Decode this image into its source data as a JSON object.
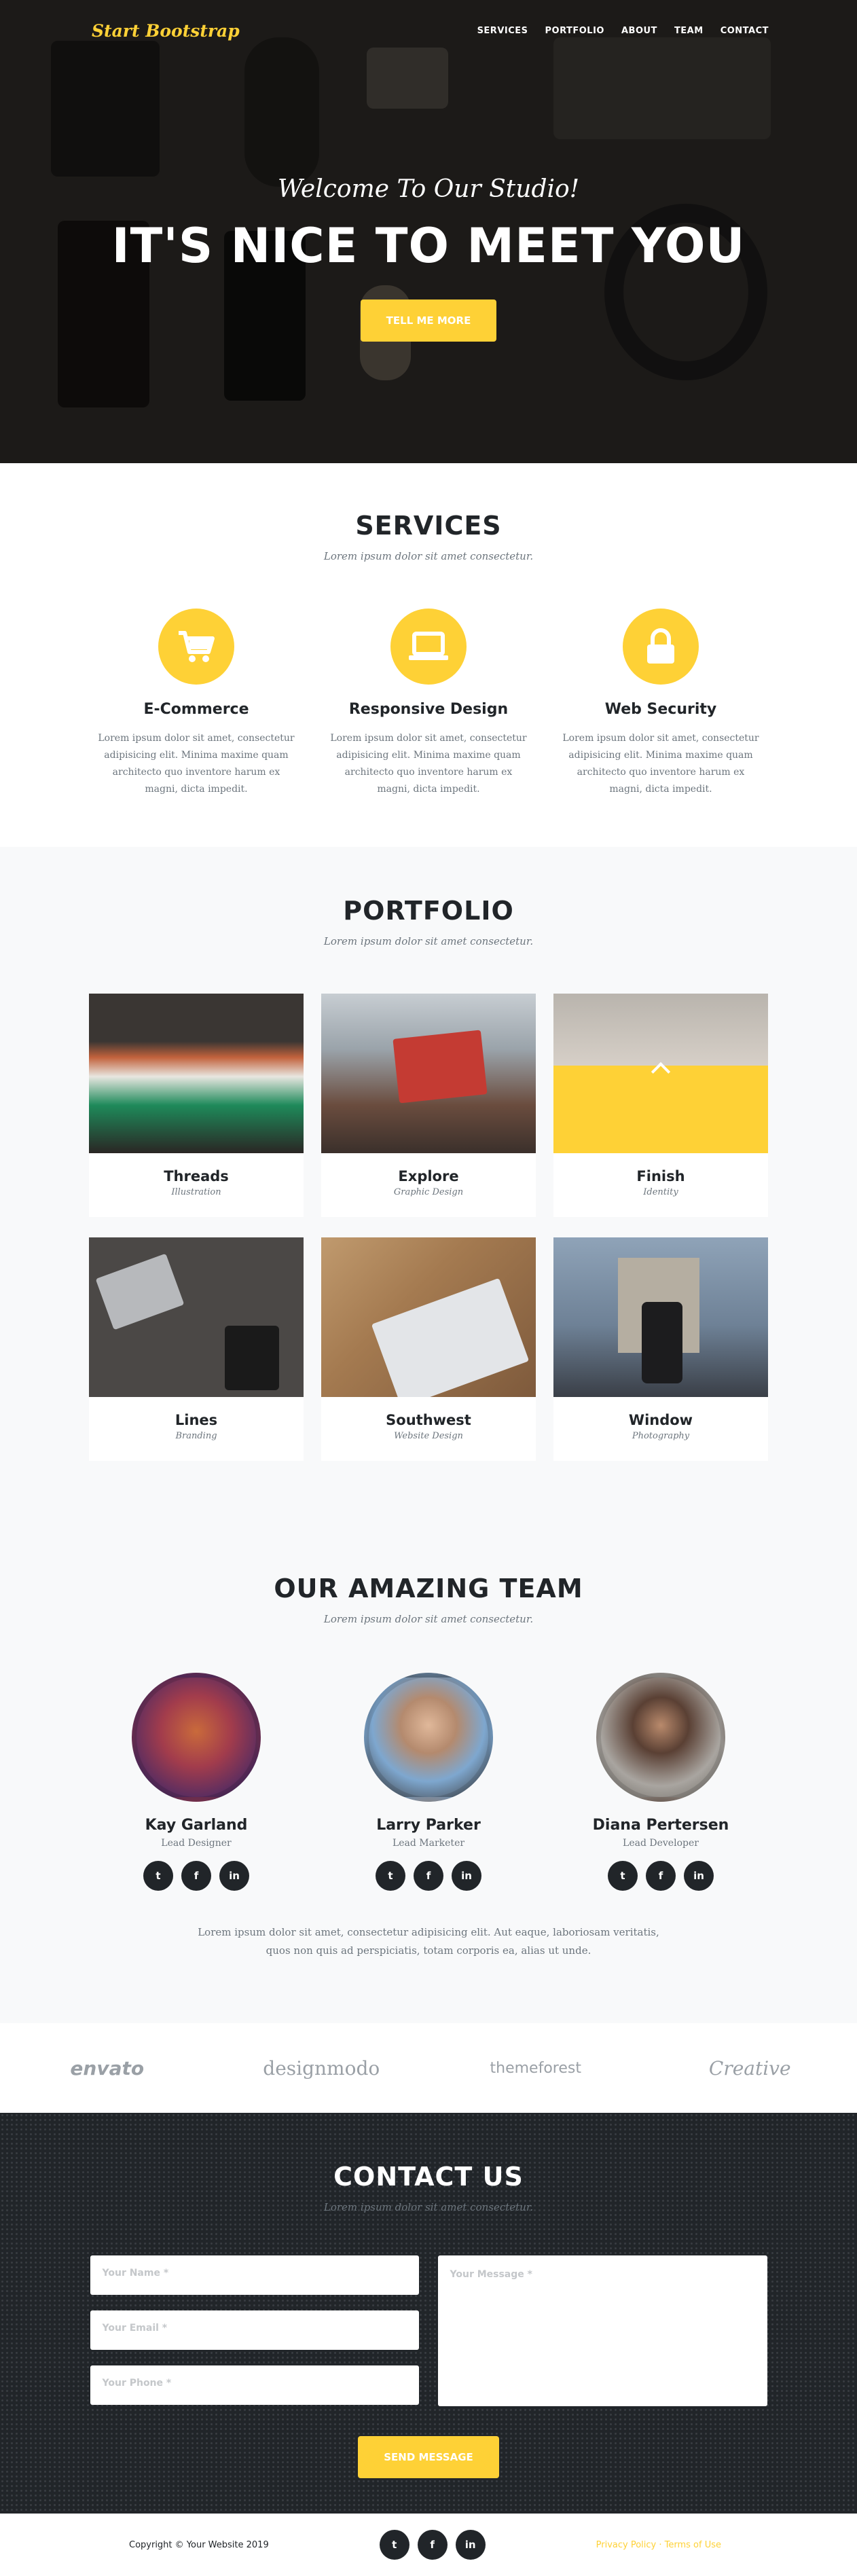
{
  "colors": {
    "accent": "#fed136",
    "dark": "#212529",
    "muted": "#6c757d"
  },
  "nav": {
    "brand": "Start Bootstrap",
    "items": [
      "SERVICES",
      "PORTFOLIO",
      "ABOUT",
      "TEAM",
      "CONTACT"
    ]
  },
  "hero": {
    "subheading": "Welcome To Our Studio!",
    "heading": "IT'S NICE TO MEET YOU",
    "button": "TELL ME MORE"
  },
  "services": {
    "title": "SERVICES",
    "subtitle": "Lorem ipsum dolor sit amet consectetur.",
    "items": [
      {
        "icon": "shopping-cart-icon",
        "title": "E-Commerce",
        "text": "Lorem ipsum dolor sit amet, consectetur adipisicing elit. Minima maxime quam architecto quo inventore harum ex magni, dicta impedit."
      },
      {
        "icon": "laptop-icon",
        "title": "Responsive Design",
        "text": "Lorem ipsum dolor sit amet, consectetur adipisicing elit. Minima maxime quam architecto quo inventore harum ex magni, dicta impedit."
      },
      {
        "icon": "lock-icon",
        "title": "Web Security",
        "text": "Lorem ipsum dolor sit amet, consectetur adipisicing elit. Minima maxime quam architecto quo inventore harum ex magni, dicta impedit."
      }
    ]
  },
  "portfolio": {
    "title": "PORTFOLIO",
    "subtitle": "Lorem ipsum dolor sit amet consectetur.",
    "items": [
      {
        "title": "Threads",
        "category": "Illustration"
      },
      {
        "title": "Explore",
        "category": "Graphic Design"
      },
      {
        "title": "Finish",
        "category": "Identity"
      },
      {
        "title": "Lines",
        "category": "Branding"
      },
      {
        "title": "Southwest",
        "category": "Website Design"
      },
      {
        "title": "Window",
        "category": "Photography"
      }
    ]
  },
  "team": {
    "title": "OUR AMAZING TEAM",
    "subtitle": "Lorem ipsum dolor sit amet consectetur.",
    "members": [
      {
        "name": "Kay Garland",
        "role": "Lead Designer"
      },
      {
        "name": "Larry Parker",
        "role": "Lead Marketer"
      },
      {
        "name": "Diana Pertersen",
        "role": "Lead Developer"
      }
    ],
    "social": [
      "t",
      "f",
      "in"
    ],
    "text": "Lorem ipsum dolor sit amet, consectetur adipisicing elit. Aut eaque, laboriosam veritatis, quos non quis ad perspiciatis, totam corporis ea, alias ut unde."
  },
  "clients": [
    "envato",
    "designmodo",
    "themeforest",
    "Creative"
  ],
  "contact": {
    "title": "CONTACT US",
    "subtitle": "Lorem ipsum dolor sit amet consectetur.",
    "name_placeholder": "Your Name *",
    "email_placeholder": "Your Email *",
    "phone_placeholder": "Your Phone *",
    "message_placeholder": "Your Message *",
    "button": "SEND MESSAGE"
  },
  "footer": {
    "copyright": "Copyright © Your Website 2019",
    "social": [
      "t",
      "f",
      "in"
    ],
    "legal": "Privacy Policy · Terms of Use"
  }
}
